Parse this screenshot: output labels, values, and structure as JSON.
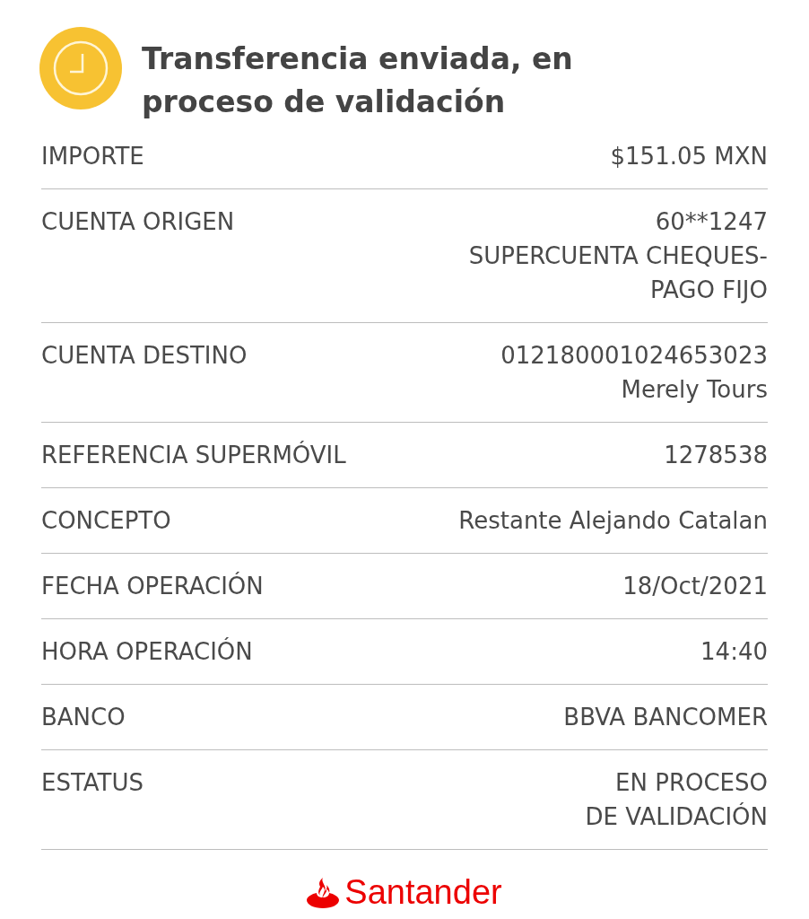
{
  "header": {
    "title": "Transferencia enviada, en proceso de validación"
  },
  "details": [
    {
      "label": "IMPORTE",
      "value": [
        "$151.05 MXN"
      ]
    },
    {
      "label": "CUENTA ORIGEN",
      "value": [
        "60**1247",
        "SUPERCUENTA CHEQUES-",
        "PAGO FIJO"
      ]
    },
    {
      "label": "CUENTA DESTINO",
      "value": [
        "012180001024653023",
        "Merely Tours"
      ]
    },
    {
      "label": "REFERENCIA SUPERMÓVIL",
      "value": [
        "1278538"
      ]
    },
    {
      "label": "CONCEPTO",
      "value": [
        "Restante Alejando Catalan"
      ]
    },
    {
      "label": "FECHA OPERACIÓN",
      "value": [
        "18/Oct/2021"
      ]
    },
    {
      "label": "HORA OPERACIÓN",
      "value": [
        "14:40"
      ]
    },
    {
      "label": "BANCO",
      "value": [
        "BBVA BANCOMER"
      ]
    },
    {
      "label": "ESTATUS",
      "value": [
        "EN PROCESO",
        "DE VALIDACIÓN"
      ]
    }
  ],
  "footer": {
    "logo_text": "Santander"
  }
}
